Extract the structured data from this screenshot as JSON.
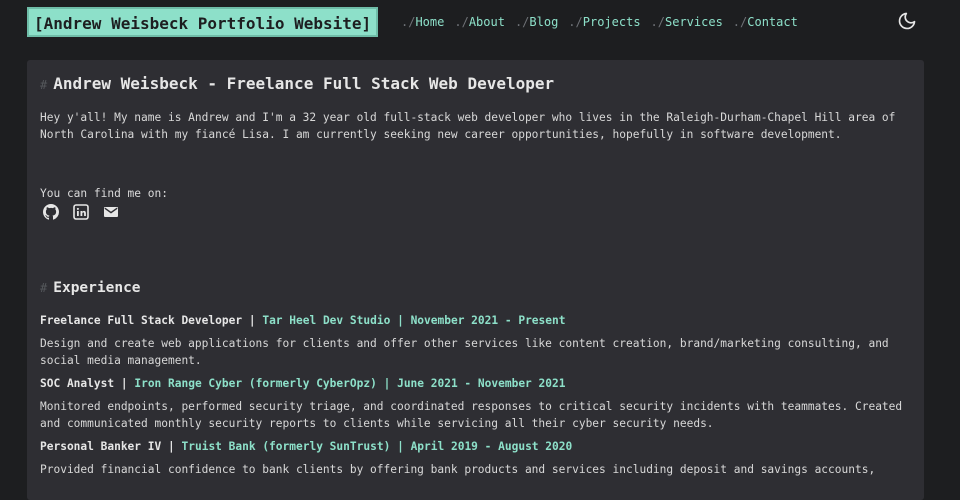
{
  "header": {
    "logo": "[Andrew Weisbeck Portfolio Website]",
    "nav": [
      {
        "prefix": "./",
        "label": "Home"
      },
      {
        "prefix": "./",
        "label": "About"
      },
      {
        "prefix": "./",
        "label": "Blog"
      },
      {
        "prefix": "./",
        "label": "Projects"
      },
      {
        "prefix": "./",
        "label": "Services"
      },
      {
        "prefix": "./",
        "label": "Contact"
      }
    ],
    "theme_icon": "moon-icon"
  },
  "main": {
    "hash": "#",
    "title": "Andrew Weisbeck - Freelance Full Stack Web Developer",
    "intro": "Hey y'all! My name is Andrew and I'm a 32 year old full-stack web developer who lives in the Raleigh-Durham-Chapel Hill area of North Carolina with my fiancé Lisa. I am currently seeking new career opportunities, hopefully in software development.",
    "find_me": "You can find me on:",
    "social": [
      {
        "icon": "github-icon"
      },
      {
        "icon": "linkedin-icon"
      },
      {
        "icon": "mail-icon"
      }
    ],
    "experience_heading": "Experience",
    "jobs": [
      {
        "role": "Freelance Full Stack Developer",
        "company": "Tar Heel Dev Studio",
        "dates": "November 2021 - Present",
        "description": "Design and create web applications for clients and offer other services like content creation, brand/marketing consulting, and social media management."
      },
      {
        "role": "SOC Analyst",
        "company": "Iron Range Cyber (formerly CyberOpz)",
        "dates": "June 2021 - November 2021",
        "description": "Monitored endpoints, performed security triage, and coordinated responses to critical security incidents with teammates. Created and communicated monthly security reports to clients while servicing all their cyber security needs."
      },
      {
        "role": "Personal Banker IV",
        "company": "Truist Bank (formerly SunTrust)",
        "dates": "April 2019 - August 2020",
        "description": "Provided financial confidence to bank clients by offering bank products and services including deposit and savings accounts,"
      }
    ],
    "separator": "|"
  },
  "colors": {
    "background": "#1d1e20",
    "card": "#2e2e33",
    "accent": "#8de0c9",
    "text": "#dadadb"
  }
}
